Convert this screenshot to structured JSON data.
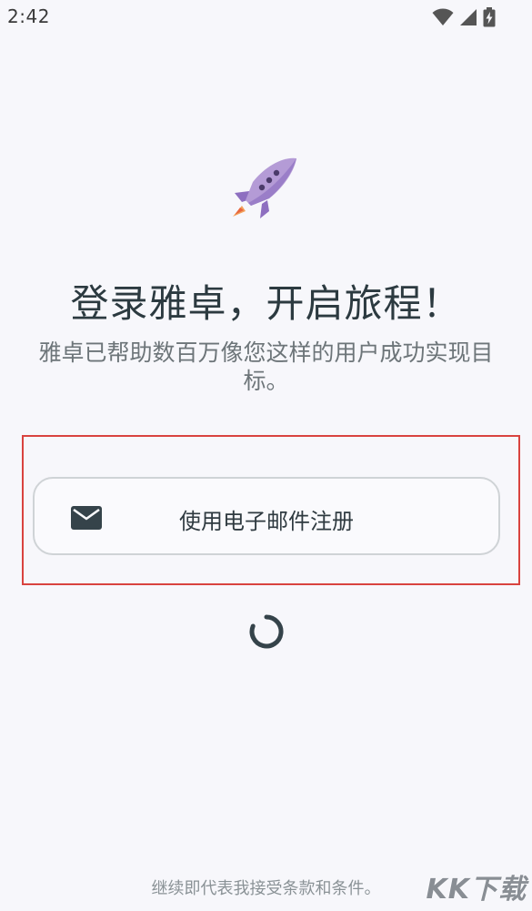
{
  "status_bar": {
    "time": "2:42",
    "icons": [
      "wifi-icon",
      "cellular-signal-icon",
      "battery-charging-icon"
    ]
  },
  "hero": {
    "icon": "rocket-icon",
    "headline": "登录雅卓，开启旅程！",
    "subtext": "雅卓已帮助数百万像您这样的用户成功实现目标。"
  },
  "email_signup": {
    "icon": "mail-icon",
    "label": "使用电子邮件注册"
  },
  "loading": {
    "icon": "loading-spinner-icon"
  },
  "footer": {
    "terms_text": "继续即代表我接受条款和条件。",
    "watermark": "KK下载"
  },
  "colors": {
    "background": "#f7f7fb",
    "text_primary": "#2c3a40",
    "text_secondary": "#6d7579",
    "highlight_border": "#d9433f",
    "rocket_purple": "#a88ccc"
  }
}
